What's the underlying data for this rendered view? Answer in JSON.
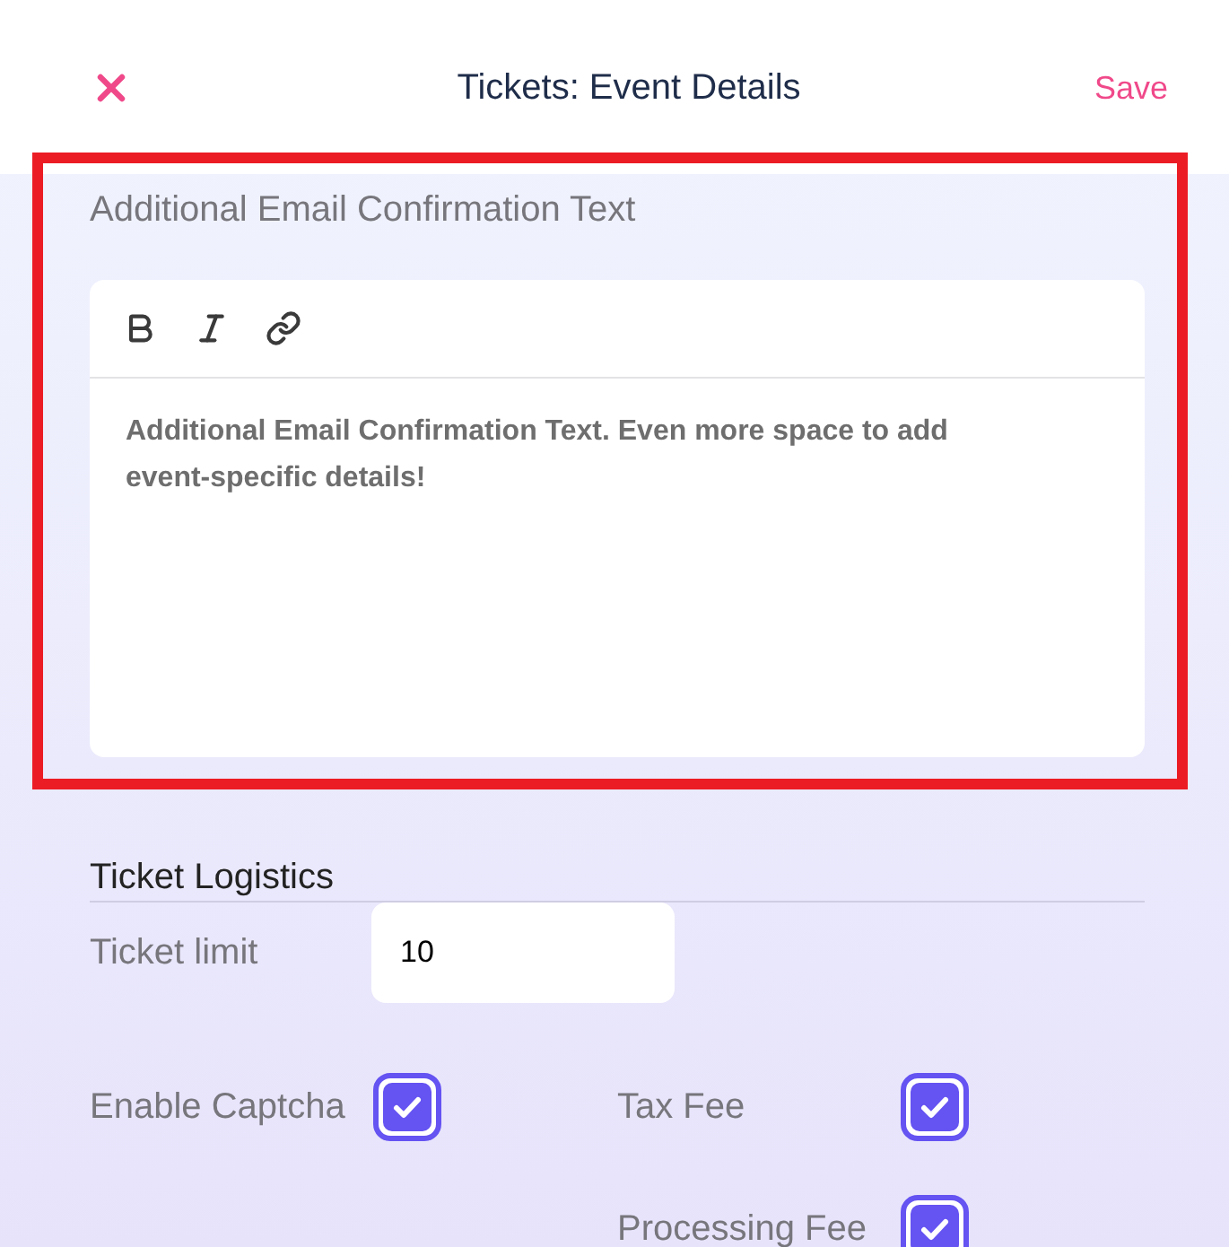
{
  "header": {
    "title": "Tickets: Event Details",
    "save": "Save"
  },
  "email_text": {
    "highlighted": true,
    "label": "Additional Email Confirmation Text",
    "toolbar": [
      {
        "kind": "bold"
      },
      {
        "kind": "italic"
      },
      {
        "kind": "link"
      }
    ],
    "body": "Additional Email Confirmation Text. Even more space to add event-specific details!"
  },
  "logistics": {
    "title": "Ticket Logistics",
    "ticket_limit": {
      "label": "Ticket limit",
      "value": "10"
    },
    "option_columns": [
      [
        {
          "label": "Enable Captcha",
          "checked": true
        }
      ],
      [
        {
          "label": "Tax Fee",
          "checked": true
        },
        {
          "label": "Processing Fee",
          "checked": true
        }
      ]
    ]
  }
}
